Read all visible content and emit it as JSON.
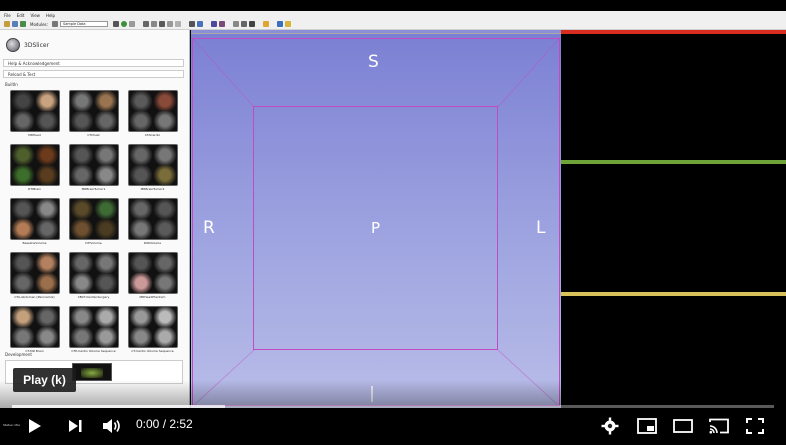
{
  "menu": [
    "File",
    "Edit",
    "View",
    "Help"
  ],
  "toolbar": {
    "modules_label": "Modules:",
    "module_select": "Sample Data"
  },
  "app": {
    "logo_text": "3DSlicer"
  },
  "panel": {
    "sections": [
      {
        "label": "Help & Acknowledgement"
      },
      {
        "label": "Reload & Test"
      }
    ],
    "builtin_label": "BuiltIn",
    "developer_label": "Development",
    "status_label": "Status: Idle",
    "samples": [
      {
        "label": "MRHead",
        "c": [
          "#444",
          "#c9a27f",
          "#666",
          "#555"
        ]
      },
      {
        "label": "CTChest",
        "c": [
          "#777",
          "#9a7450",
          "#555",
          "#666"
        ]
      },
      {
        "label": "CTACardio",
        "c": [
          "#5a5a5a",
          "#8a4a3a",
          "#666",
          "#777"
        ]
      },
      {
        "label": "DTIBrain",
        "c": [
          "#4f5f2c",
          "#6c3b1c",
          "#3d6d2a",
          "#5a3d1f"
        ]
      },
      {
        "label": "MRBrainTumor1",
        "c": [
          "#555",
          "#777",
          "#666",
          "#888"
        ]
      },
      {
        "label": "MRBrainTumor2",
        "c": [
          "#666",
          "#777",
          "#555",
          "#7a6d3a"
        ]
      },
      {
        "label": "BaselineVolume",
        "c": [
          "#555",
          "#888",
          "#b37c56",
          "#666"
        ]
      },
      {
        "label": "DTIVolume",
        "c": [
          "#5a4a2a",
          "#3e6a34",
          "#6e5030",
          "#4a3c22"
        ]
      },
      {
        "label": "DWIVolume",
        "c": [
          "#666",
          "#555",
          "#777",
          "#5a5a5a"
        ]
      },
      {
        "label": "CTA-Abdomen (Panoramix)",
        "c": [
          "#555",
          "#b38060",
          "#666",
          "#9c6f4c"
        ]
      },
      {
        "label": "CBCT-Dental-Surgery",
        "c": [
          "#666",
          "#777",
          "#888",
          "#555"
        ]
      },
      {
        "label": "MRHeadPhantom",
        "c": [
          "#555",
          "#666",
          "#c99",
          "#777"
        ]
      },
      {
        "label": "CT-MR Brain",
        "c": [
          "#c4a07c",
          "#666",
          "#777",
          "#888"
        ]
      },
      {
        "label": "CTP-Cardio Volume Sequence",
        "c": [
          "#888",
          "#aaa",
          "#777",
          "#999"
        ]
      },
      {
        "label": "CT-Cardio Volume Sequence",
        "c": [
          "#999",
          "#bbb",
          "#888",
          "#aaa"
        ]
      }
    ]
  },
  "view3d": {
    "orient_superior": "S",
    "orient_right": "R",
    "orient_posterior": "P",
    "orient_left": "L"
  },
  "colors": {
    "red_slice": "#d62d20",
    "green_slice": "#6ea33a",
    "yellow_slice": "#d9c25a",
    "box": "#c04cc4"
  },
  "player": {
    "time_current": "0:00",
    "time_total": "2:52",
    "tooltip": "Play (k)",
    "progress": 0.28
  }
}
